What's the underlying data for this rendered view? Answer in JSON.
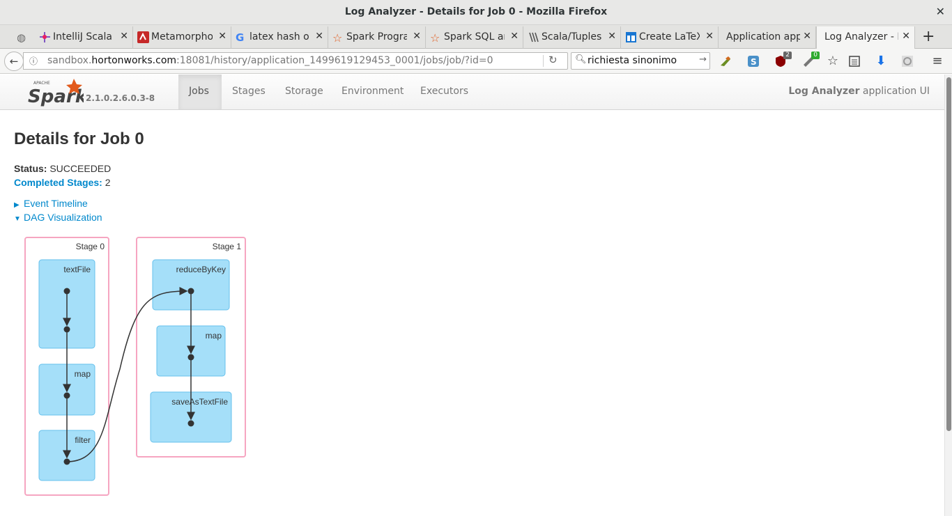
{
  "window": {
    "title": "Log Analyzer - Details for Job 0 - Mozilla Firefox"
  },
  "tabs": [
    {
      "label": "IntelliJ Scala"
    },
    {
      "label": "Metamorpho"
    },
    {
      "label": "latex hash op"
    },
    {
      "label": "Spark Prograi"
    },
    {
      "label": "Spark SQL ar"
    },
    {
      "label": "Scala/Tuples"
    },
    {
      "label": "Create LaTeX"
    },
    {
      "label": "Application appli"
    },
    {
      "label": "Log Analyzer - D"
    }
  ],
  "navbar": {
    "url_host": "sandbox.",
    "url_domain": "hortonworks.com",
    "url_rest": ":18081/history/application_1499619129453_0001/jobs/job/?id=0",
    "search_value": "richiesta sinonimo",
    "badge_ublock": "2",
    "badge_ext": "0"
  },
  "spark": {
    "logo_small": "APACHE",
    "logo_word": "Spark",
    "version": "2.1.0.2.6.0.3-8",
    "tabs": [
      "Jobs",
      "Stages",
      "Storage",
      "Environment",
      "Executors"
    ],
    "app_name": "Log Analyzer",
    "app_suffix": " application UI"
  },
  "page": {
    "title": "Details for Job 0",
    "status_label": "Status:",
    "status_value": "SUCCEEDED",
    "completed_label": "Completed Stages:",
    "completed_value": "2",
    "event_timeline": "Event Timeline",
    "dag_visualization": "DAG Visualization"
  },
  "dag": {
    "stages": [
      {
        "label": "Stage 0",
        "ops": [
          "textFile",
          "map",
          "filter"
        ]
      },
      {
        "label": "Stage 1",
        "ops": [
          "reduceByKey",
          "map",
          "saveAsTextFile"
        ]
      }
    ]
  },
  "colors": {
    "link": "#0088cc",
    "stage_border": "#f6a5c1",
    "op_fill": "#a5dff9",
    "op_border": "#66c1ec"
  }
}
